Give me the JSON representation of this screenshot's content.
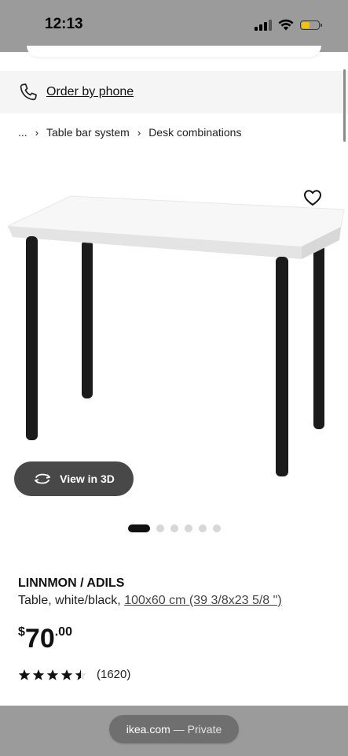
{
  "status_bar": {
    "time": "12:13",
    "signal_icon": "cellular-signal-icon",
    "wifi_icon": "wifi-icon",
    "battery_icon": "battery-icon",
    "battery_color": "#f5c400"
  },
  "phone_banner": {
    "icon": "phone-icon",
    "label": "Order by phone"
  },
  "breadcrumb": {
    "items": [
      "...",
      "Table bar system",
      "Desk combinations"
    ],
    "separator_icon": "chevron-right-icon"
  },
  "product_image": {
    "wishlist_icon": "heart-icon",
    "view_3d_icon": "rotate-3d-icon",
    "view_3d_label": "View in 3D",
    "carousel_total": 6,
    "carousel_active": 1
  },
  "product": {
    "name": "LINNMON / ADILS",
    "description": "Table, white/black, ",
    "size_link": "100x60 cm (39 3/8x23 5/8 \")",
    "price_currency": "$",
    "price_integer": "70",
    "price_decimal": ".00",
    "rating_value": 4.5,
    "rating_count": "(1620)",
    "star_icon": "star-icon"
  },
  "browser": {
    "url": "ikea.com",
    "mode": "— Private"
  }
}
